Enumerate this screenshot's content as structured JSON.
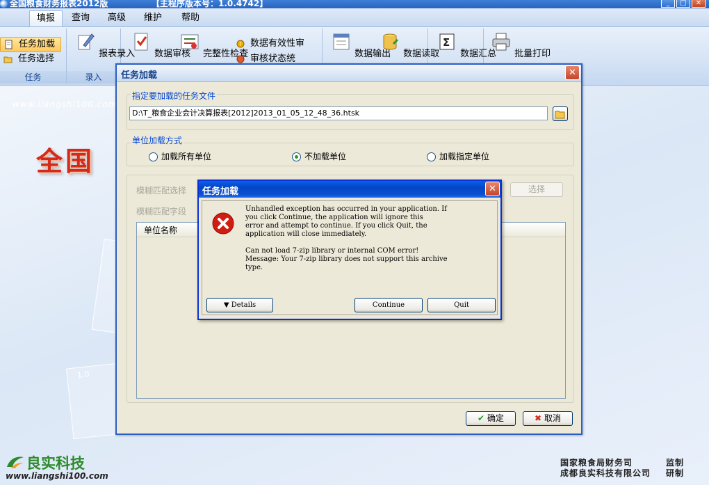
{
  "window": {
    "title": "全国粮食财务报表2012版",
    "version": "【主程序版本号：1.0.4742】",
    "min": "_",
    "max": "□",
    "close": "✕"
  },
  "menu": {
    "tabs": [
      "填报",
      "查询",
      "高级",
      "维护",
      "帮助"
    ],
    "active": "填报"
  },
  "ribbon": {
    "task_group": {
      "load": "任务加载",
      "select": "任务选择",
      "label": "任务"
    },
    "entry_group": {
      "entry": "报表录入",
      "label": "录入"
    },
    "audit": "数据审核",
    "integrity": "完整性检查",
    "validity": "数据有效性审",
    "audit_status": "审核状态统",
    "export": "数据输出",
    "import": "数据读取",
    "summary": "数据汇总",
    "batch_print": "批量打印"
  },
  "background": {
    "url_top": "www.liangshi100.com",
    "big_brand": "全国",
    "brand_name": "良实科技",
    "url_bottom": "www.liangshi100.com",
    "credit1_org": "国家粮食局财务司",
    "credit1_role": "监制",
    "credit2_org": "成都良实科技有限公司",
    "credit2_role": "研制",
    "deco_version": "1.0"
  },
  "task_dialog": {
    "title": "任务加载",
    "file_group_title": "指定要加载的任务文件",
    "file_path": "D:\\T_粮食企业会计决算报表[2012]2013_01_05_12_48_36.htsk",
    "mode_group_title": "单位加载方式",
    "radios": [
      {
        "label": "加载所有单位",
        "checked": false
      },
      {
        "label": "不加载单位",
        "checked": true
      },
      {
        "label": "加载指定单位",
        "checked": false
      }
    ],
    "fuzzy_select": "模糊匹配选择",
    "fuzzy_field": "模糊匹配字段",
    "select_button": "选择",
    "list_header": "单位名称",
    "ok_button": "确定",
    "cancel_button": "取消"
  },
  "error_dialog": {
    "title": "任务加载",
    "message": "Unhandled exception has occurred in your application. If\nyou click Continue, the application will ignore this\nerror and attempt to continue. If you click Quit, the\napplication will close immediately.\n\nCan not load 7-zip library or internal COM error!\nMessage: Your 7-zip library does not support this archive\ntype.",
    "details_button": "Details",
    "continue_button": "Continue",
    "quit_button": "Quit"
  }
}
